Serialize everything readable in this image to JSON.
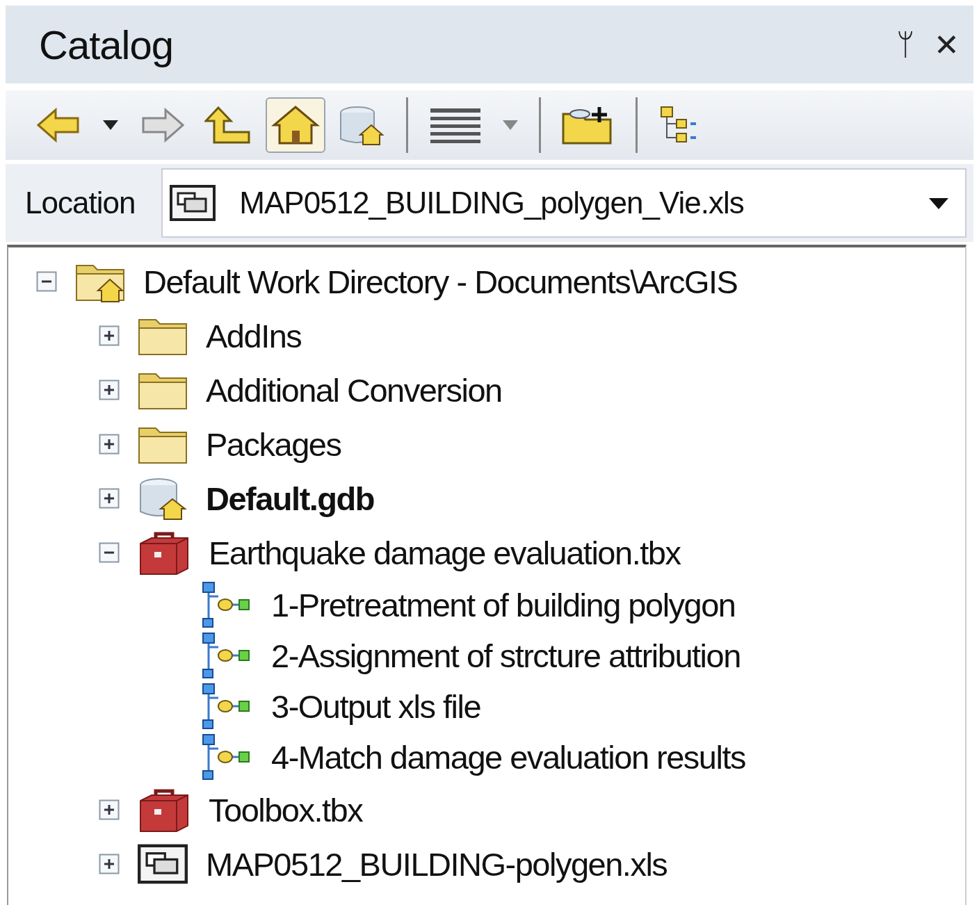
{
  "window": {
    "title": "Catalog",
    "pin": "ᛘ",
    "close": "✕"
  },
  "toolbar": [
    {
      "kind": "back",
      "pressed": false
    },
    {
      "kind": "caret",
      "pressed": false
    },
    {
      "kind": "forward",
      "pressed": false
    },
    {
      "kind": "up",
      "pressed": false
    },
    {
      "kind": "home",
      "pressed": true
    },
    {
      "kind": "gdb",
      "pressed": false
    },
    {
      "kind": "sep"
    },
    {
      "kind": "grid",
      "pressed": false
    },
    {
      "kind": "caret",
      "pressed": false
    },
    {
      "kind": "sep"
    },
    {
      "kind": "connect",
      "pressed": false
    },
    {
      "kind": "sep"
    },
    {
      "kind": "tree",
      "pressed": false
    }
  ],
  "location": {
    "label": "Location",
    "value": "MAP0512_BUILDING_polygen_Vie.xls"
  },
  "tree": [
    {
      "label": "Default Work Directory - Documents\\ArcGIS",
      "kind": "home-folder",
      "expanded": true,
      "children": [
        {
          "label": "AddIns",
          "kind": "folder",
          "expanded": false
        },
        {
          "label": "Additional Conversion",
          "kind": "folder",
          "expanded": false
        },
        {
          "label": "Packages",
          "kind": "folder",
          "expanded": false
        },
        {
          "label": "Default.gdb",
          "kind": "gdb",
          "expanded": false,
          "default": true
        },
        {
          "label": "Earthquake damage evaluation.tbx",
          "kind": "toolbox",
          "expanded": true,
          "children": [
            {
              "label": "1-Pretreatment of building polygon",
              "kind": "model"
            },
            {
              "label": "2-Assignment of strcture attribution",
              "kind": "model"
            },
            {
              "label": "3-Output xls file",
              "kind": "model"
            },
            {
              "label": "4-Match damage evaluation results",
              "kind": "model"
            }
          ]
        },
        {
          "label": "Toolbox.tbx",
          "kind": "toolbox",
          "expanded": false
        },
        {
          "label": "MAP0512_BUILDING-polygen.xls",
          "kind": "table",
          "expanded": false
        }
      ]
    }
  ]
}
